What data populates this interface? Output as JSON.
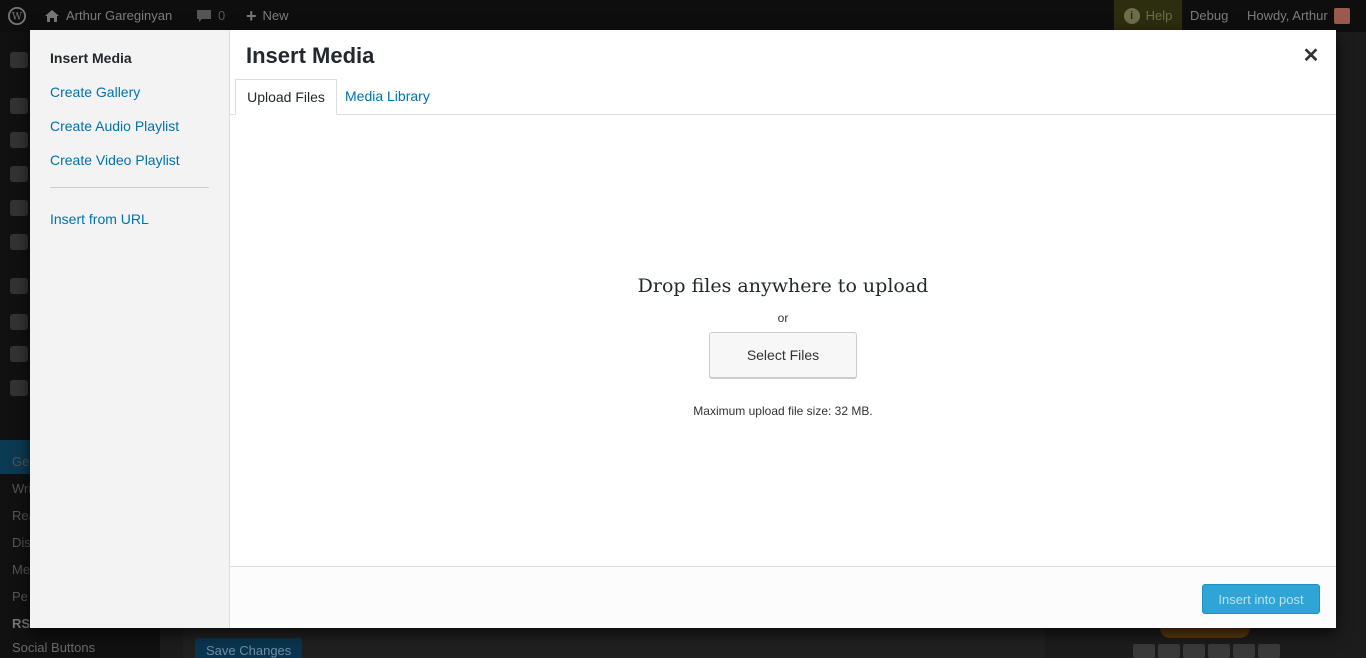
{
  "admin_bar": {
    "site_name": "Arthur Gareginyan",
    "comments_count": "0",
    "new_label": "New",
    "help_label": "Help",
    "debug_label": "Debug",
    "howdy_label": "Howdy, Arthur"
  },
  "admin_menu": {
    "submenu": [
      "Ge",
      "Wri",
      "Rea",
      "Dis",
      "Me",
      "Pe",
      "RS"
    ],
    "social_buttons": "Social Buttons"
  },
  "background_page": {
    "save_changes": "Save Changes"
  },
  "modal": {
    "title": "Insert Media",
    "menu": {
      "items": [
        "Insert Media",
        "Create Gallery",
        "Create Audio Playlist",
        "Create Video Playlist"
      ],
      "insert_from_url": "Insert from URL"
    },
    "tabs": [
      "Upload Files",
      "Media Library"
    ],
    "upload": {
      "drop_title": "Drop files anywhere to upload",
      "or": "or",
      "select_files": "Select Files",
      "max_size": "Maximum upload file size: 32 MB."
    },
    "toolbar": {
      "insert_label": "Insert into post"
    }
  }
}
